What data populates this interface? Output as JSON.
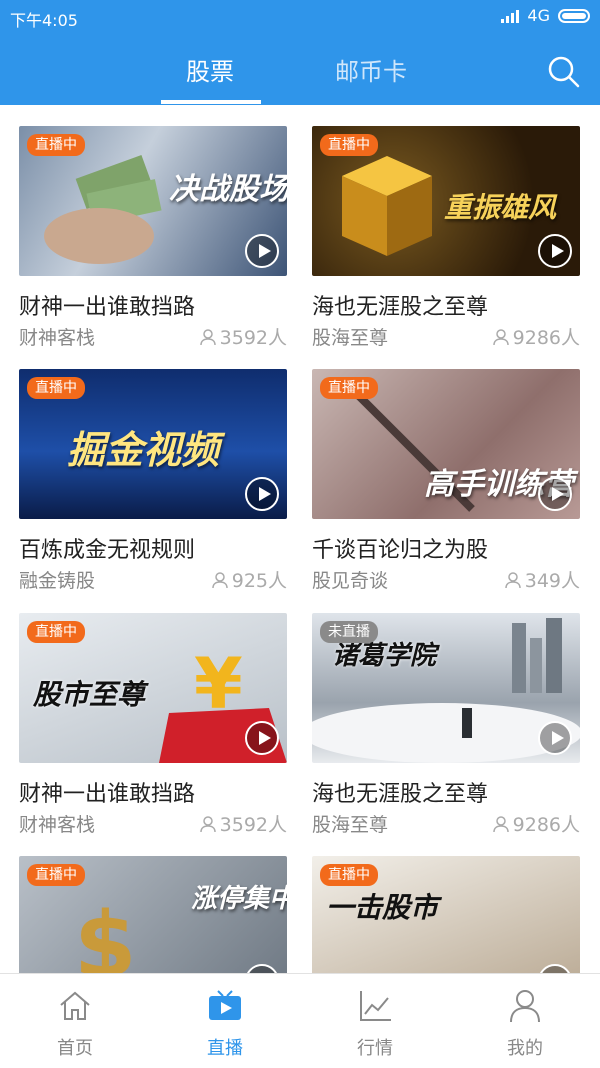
{
  "status_bar": {
    "time": "下午4:05",
    "network": "4G"
  },
  "tabs": [
    {
      "label": "股票",
      "active": true
    },
    {
      "label": "邮币卡",
      "active": false
    }
  ],
  "cards": [
    {
      "title": "财神一出谁敢挡路",
      "host": "财神客栈",
      "viewers": "3592人",
      "badge": "直播中",
      "thumb_text": "决战股场",
      "live": true
    },
    {
      "title": "海也无涯股之至尊",
      "host": "股海至尊",
      "viewers": "9286人",
      "badge": "直播中",
      "thumb_text": "重振雄风",
      "live": true
    },
    {
      "title": "百炼成金无视规则",
      "host": "融金铸股",
      "viewers": "925人",
      "badge": "直播中",
      "thumb_text": "掘金视频",
      "live": true
    },
    {
      "title": "千谈百论归之为股",
      "host": "股见奇谈",
      "viewers": "349人",
      "badge": "直播中",
      "thumb_text": "高手训练营",
      "live": true
    },
    {
      "title": "财神一出谁敢挡路",
      "host": "财神客栈",
      "viewers": "3592人",
      "badge": "直播中",
      "thumb_text": "股市至尊",
      "live": true
    },
    {
      "title": "海也无涯股之至尊",
      "host": "股海至尊",
      "viewers": "9286人",
      "badge": "未直播",
      "thumb_text": "诸葛学院",
      "live": false
    },
    {
      "title": "",
      "host": "",
      "viewers": "",
      "badge": "直播中",
      "thumb_text": "涨停集中",
      "live": true
    },
    {
      "title": "",
      "host": "",
      "viewers": "",
      "badge": "直播中",
      "thumb_text": "一击股市",
      "live": true
    }
  ],
  "bottom_nav": [
    {
      "label": "首页",
      "icon": "home-icon",
      "active": false
    },
    {
      "label": "直播",
      "icon": "tv-icon",
      "active": true
    },
    {
      "label": "行情",
      "icon": "chart-icon",
      "active": false
    },
    {
      "label": "我的",
      "icon": "user-icon",
      "active": false
    }
  ],
  "colors": {
    "primary": "#2f95ea",
    "live_badge": "#f26a1b",
    "offline_badge": "#8a8a8a"
  }
}
